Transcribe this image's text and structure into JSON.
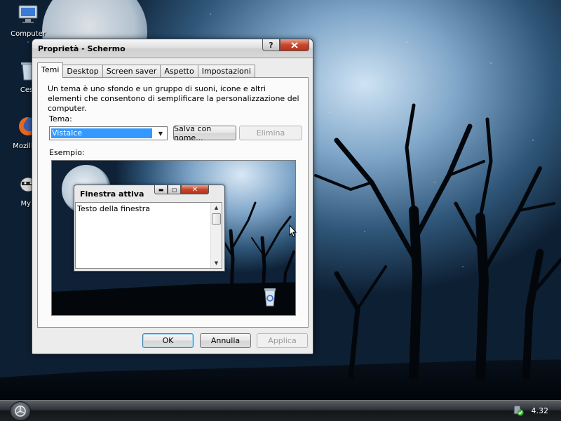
{
  "desktop": {
    "icons": [
      {
        "label": "Computer"
      },
      {
        "label": "Cest"
      },
      {
        "label": "Mozilla F"
      },
      {
        "label": "Myp"
      }
    ]
  },
  "dialog": {
    "title": "Proprietà - Schermo",
    "help_label": "?",
    "tabs": [
      {
        "label": "Temi",
        "active": true
      },
      {
        "label": "Desktop"
      },
      {
        "label": "Screen saver"
      },
      {
        "label": "Aspetto"
      },
      {
        "label": "Impostazioni"
      }
    ],
    "description": "Un tema è uno sfondo e un gruppo di suoni, icone e altri elementi che consentono di semplificare la personalizzazione del computer.",
    "theme_label": "Tema:",
    "theme_value": "VistaIce",
    "save_as_label": "Salva con nome...",
    "delete_label": "Elimina",
    "example_label": "Esempio:",
    "preview": {
      "window_title": "Finestra attiva",
      "window_text": "Testo della finestra"
    },
    "ok_label": "OK",
    "cancel_label": "Annulla",
    "apply_label": "Applica"
  },
  "taskbar": {
    "clock": "4.32"
  },
  "colors": {
    "selection": "#3399ff",
    "close_button": "#c8462c"
  }
}
